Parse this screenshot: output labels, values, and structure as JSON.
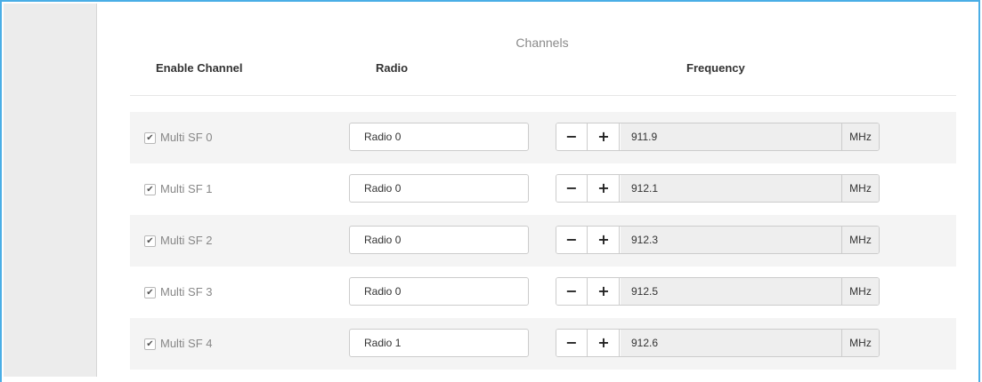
{
  "section_title": "Channels",
  "columns": {
    "enable": "Enable Channel",
    "radio": "Radio",
    "frequency": "Frequency"
  },
  "stepper": {
    "minus": "−",
    "plus": "+"
  },
  "check_glyph": "✔",
  "channels": [
    {
      "label": "Multi SF 0",
      "enabled": true,
      "radio": "Radio 0",
      "frequency": "911.9",
      "unit": "MHz"
    },
    {
      "label": "Multi SF 1",
      "enabled": true,
      "radio": "Radio 0",
      "frequency": "912.1",
      "unit": "MHz"
    },
    {
      "label": "Multi SF 2",
      "enabled": true,
      "radio": "Radio 0",
      "frequency": "912.3",
      "unit": "MHz"
    },
    {
      "label": "Multi SF 3",
      "enabled": true,
      "radio": "Radio 0",
      "frequency": "912.5",
      "unit": "MHz"
    },
    {
      "label": "Multi SF 4",
      "enabled": true,
      "radio": "Radio 1",
      "frequency": "912.6",
      "unit": "MHz"
    }
  ]
}
